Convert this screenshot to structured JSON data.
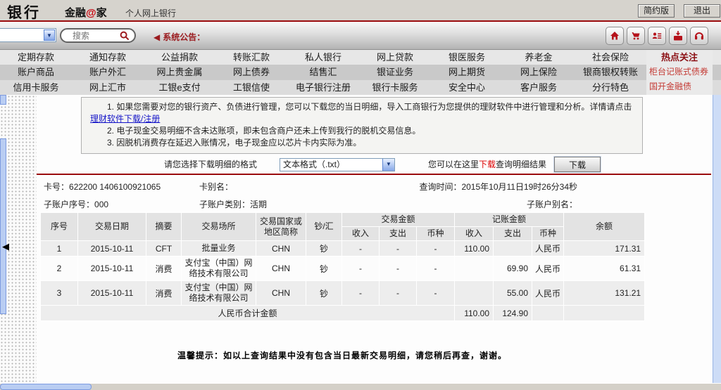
{
  "window": {
    "bank_label": "银行",
    "brand_pre": "金融",
    "brand_at": "@",
    "brand_post": "家",
    "subtitle": "个人网上银行",
    "btn_simple": "简约版",
    "btn_logout": "退出"
  },
  "toolbar": {
    "search_placeholder": "搜索",
    "announcement_marker": "◀",
    "announcement": "系统公告：",
    "icons": [
      "home-icon",
      "shopping-cart-icon",
      "contacts-icon",
      "mail-download-icon",
      "customer-service-icon"
    ],
    "accent_red": "#b5121b"
  },
  "nav": {
    "rows": [
      [
        "定期存款",
        "通知存款",
        "公益捐款",
        "转账汇款",
        "私人银行",
        "网上贷款",
        "银医服务",
        "养老金",
        "社会保险"
      ],
      [
        "账户商品",
        "账户外汇",
        "网上贵金属",
        "网上债券",
        "结售汇",
        "银证业务",
        "网上期货",
        "网上保险",
        "银商银权转账"
      ],
      [
        "信用卡服务",
        "网上汇市",
        "工银e支付",
        "工银信使",
        "电子银行注册",
        "银行卡服务",
        "安全中心",
        "客户服务",
        "分行特色"
      ]
    ],
    "hot": {
      "title": "热点关注",
      "items": [
        "柜台记账式债券",
        "国开金融债"
      ]
    }
  },
  "notice": {
    "line1_pre": "1. 如果您需要对您的银行资产、负债进行管理，您可以下载您的当日明细，导入工商银行为您提供的理财软件中进行管理和分析。详情请点击",
    "line1_link": "理财软件下载/注册",
    "line2": "2. 电子现金交易明细不含未达账项，即未包含商户还未上传到我行的脱机交易信息。",
    "line3": "3. 因脱机消费存在延迟入账情况，电子现金应以芯片卡内实际为准。"
  },
  "download": {
    "format_label": "请您选择下载明细的格式",
    "format_value": "文本格式（.txt）",
    "hint_pre": "您可以在这里",
    "hint_em": "下载",
    "hint_post": "查询明细结果",
    "button_label": "下载"
  },
  "account": {
    "card_no_label": "卡号：",
    "card_no": "622200 1406100921065",
    "card_alias_label": "卡别名：",
    "card_alias": "",
    "query_time_label": "查询时间：",
    "query_time": "2015年10月11日19时26分34秒",
    "sub_seq_label": "子账户序号：",
    "sub_seq": "000",
    "sub_type_label": "子账户类别：",
    "sub_type": "活期",
    "sub_alias_label": "子账户别名：",
    "sub_alias": ""
  },
  "table": {
    "headers": {
      "seq": "序号",
      "date": "交易日期",
      "abstract": "摘要",
      "place": "交易场所",
      "country": "交易国家或地区简称",
      "cash": "钞/汇",
      "txn_group": "交易金额",
      "book_group": "记账金额",
      "income": "收入",
      "expense": "支出",
      "currency": "币种",
      "balance": "余额"
    },
    "rows": [
      [
        "1",
        "2015-10-11",
        "CFT",
        "批量业务",
        "CHN",
        "钞",
        "-",
        "-",
        "-",
        "110.00",
        "",
        "人民币",
        "171.31"
      ],
      [
        "2",
        "2015-10-11",
        "消费",
        "支付宝（中国）网络技术有限公司",
        "CHN",
        "钞",
        "-",
        "-",
        "-",
        "",
        "69.90",
        "人民币",
        "61.31"
      ],
      [
        "3",
        "2015-10-11",
        "消费",
        "支付宝（中国）网络技术有限公司",
        "CHN",
        "钞",
        "-",
        "-",
        "-",
        "",
        "55.00",
        "人民币",
        "131.21"
      ]
    ],
    "summary": {
      "label": "人民币合计金额",
      "income": "110.00",
      "expense": "124.90"
    }
  },
  "tip": "温馨提示：如以上查询结果中没有包含当日最新交易明细，请您稍后再查，谢谢。"
}
